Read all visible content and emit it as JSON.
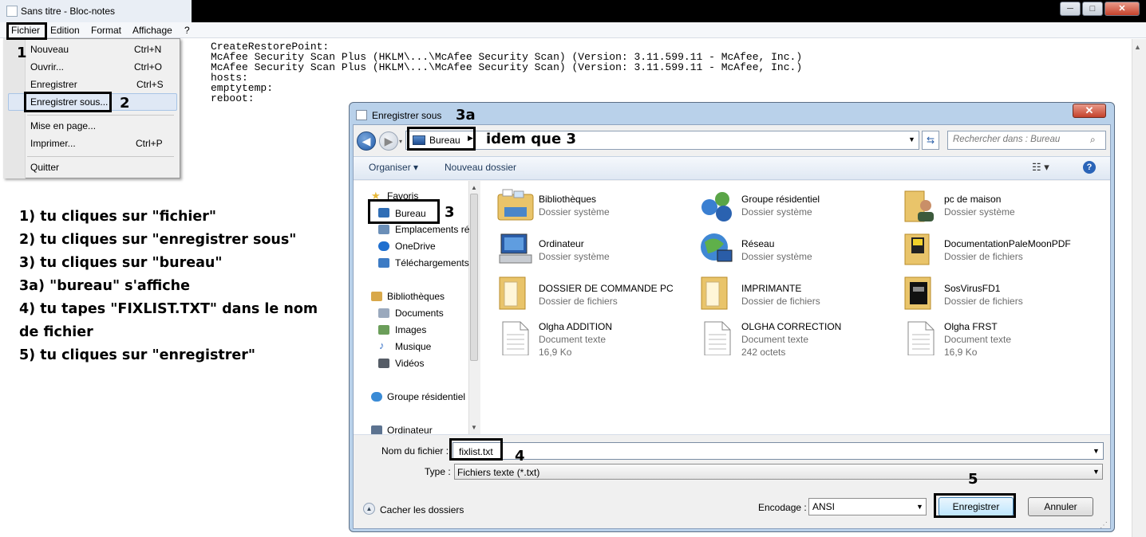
{
  "notepad": {
    "title": "Sans titre - Bloc-notes",
    "window_buttons": [
      "─",
      "□",
      "✕"
    ],
    "menu": [
      "Fichier",
      "Edition",
      "Format",
      "Affichage",
      "?"
    ],
    "content_lines": [
      "CreateRestorePoint:",
      "McAfee Security Scan Plus (HKLM\\...\\McAfee Security Scan) (Version: 3.11.599.11 - McAfee, Inc.)",
      "McAfee Security Scan Plus (HKLM\\...\\McAfee Security Scan) (Version: 3.11.599.11 - McAfee, Inc.)",
      "hosts:",
      "emptytemp:",
      "reboot:"
    ]
  },
  "file_menu": {
    "items": [
      {
        "label": "Nouveau",
        "shortcut": "Ctrl+N"
      },
      {
        "label": "Ouvrir...",
        "shortcut": "Ctrl+O"
      },
      {
        "label": "Enregistrer",
        "shortcut": "Ctrl+S"
      },
      {
        "label": "Enregistrer sous...",
        "shortcut": ""
      },
      {
        "label": "Mise en page...",
        "shortcut": ""
      },
      {
        "label": "Imprimer...",
        "shortcut": "Ctrl+P"
      },
      {
        "label": "Quitter",
        "shortcut": ""
      }
    ]
  },
  "annotations": {
    "n1": "1",
    "n2": "2",
    "n3": "3",
    "n3a": "3a",
    "n4": "4",
    "n5": "5",
    "idem": "idem que 3"
  },
  "instructions": [
    "1) tu cliques sur \"fichier\"",
    "2) tu cliques sur \"enregistrer sous\"",
    "3) tu cliques sur \"bureau\"",
    "3a) \"bureau\" s'affiche",
    "4) tu tapes \"FIXLIST.TXT\" dans le nom",
    "de fichier",
    "5) tu cliques sur \"enregistrer\""
  ],
  "dialog": {
    "title": "Enregistrer sous",
    "close": "✕",
    "address": "Bureau",
    "search_placeholder": "Rechercher dans : Bureau",
    "toolbar": {
      "organize": "Organiser ▾",
      "new_folder": "Nouveau dossier",
      "help": "?"
    },
    "nav_items": [
      {
        "label": "Favoris",
        "color": "#e8b93a"
      },
      {
        "label": "Bureau",
        "color": "#2f6db5"
      },
      {
        "label": "Emplacements ré",
        "color": "#6b8fb8"
      },
      {
        "label": "OneDrive",
        "color": "#1f6fcf"
      },
      {
        "label": "Téléchargements",
        "color": "#3d7bc4"
      },
      {
        "label": "Bibliothèques",
        "color": "#d8a84a"
      },
      {
        "label": "Documents",
        "color": "#9aa9bd"
      },
      {
        "label": "Images",
        "color": "#6b9e5a"
      },
      {
        "label": "Musique",
        "color": "#3b73c8"
      },
      {
        "label": "Vidéos",
        "color": "#555c66"
      },
      {
        "label": "Groupe résidentiel",
        "color": "#3a8bd6"
      },
      {
        "label": "Ordinateur",
        "color": "#5c7390"
      }
    ],
    "files": [
      {
        "name": "Bibliothèques",
        "type": "Dossier système",
        "size": "",
        "icon": "library-icon"
      },
      {
        "name": "Groupe résidentiel",
        "type": "Dossier système",
        "size": "",
        "icon": "homegroup-icon"
      },
      {
        "name": "pc de maison",
        "type": "Dossier système",
        "size": "",
        "icon": "user-folder-icon"
      },
      {
        "name": "Ordinateur",
        "type": "Dossier système",
        "size": "",
        "icon": "computer-icon"
      },
      {
        "name": "Réseau",
        "type": "Dossier système",
        "size": "",
        "icon": "network-icon"
      },
      {
        "name": "DocumentationPaleMoonPDF",
        "type": "Dossier de fichiers",
        "size": "",
        "icon": "folder-icon"
      },
      {
        "name": "DOSSIER DE COMMANDE PC",
        "type": "Dossier de fichiers",
        "size": "",
        "icon": "folder-icon"
      },
      {
        "name": "IMPRIMANTE",
        "type": "Dossier de fichiers",
        "size": "",
        "icon": "folder-icon"
      },
      {
        "name": "SosVirusFD1",
        "type": "Dossier de fichiers",
        "size": "",
        "icon": "folder-icon"
      },
      {
        "name": "Olgha ADDITION",
        "type": "Document texte",
        "size": "16,9 Ko",
        "icon": "text-file-icon"
      },
      {
        "name": "OLGHA CORRECTION",
        "type": "Document texte",
        "size": "242 octets",
        "icon": "text-file-icon"
      },
      {
        "name": "Olgha FRST",
        "type": "Document texte",
        "size": "16,9 Ko",
        "icon": "text-file-icon"
      }
    ],
    "filename_label": "Nom du fichier :",
    "filename_value": "fixlist.txt",
    "type_label": "Type :",
    "type_value": "Fichiers texte (*.txt)",
    "hide_folders": "Cacher les dossiers",
    "encoding_label": "Encodage :",
    "encoding_value": "ANSI",
    "save_button": "Enregistrer",
    "cancel_button": "Annuler"
  }
}
